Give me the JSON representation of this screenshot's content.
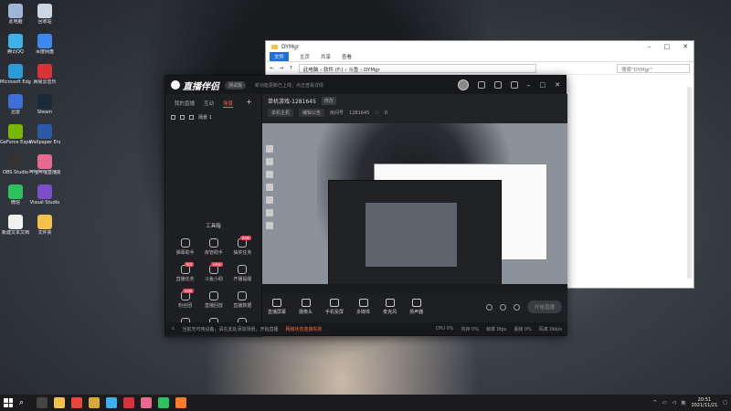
{
  "desktop": {
    "icons": [
      {
        "label": "此电脑",
        "color": "#9fb6d6"
      },
      {
        "label": "回收站",
        "color": "#cdd6e0"
      },
      {
        "label": "腾讯QQ",
        "color": "#3fb0e8"
      },
      {
        "label": "百度网盘",
        "color": "#3f88ef"
      },
      {
        "label": "Microsoft Edge",
        "color": "#2f9ad8"
      },
      {
        "label": "网易云音乐",
        "color": "#d8333a"
      },
      {
        "label": "迅雷",
        "color": "#3f6fd6"
      },
      {
        "label": "Steam",
        "color": "#1b2838"
      },
      {
        "label": "GeForce Experience",
        "color": "#76b900"
      },
      {
        "label": "Wallpaper Engine",
        "color": "#2a5aa6"
      },
      {
        "label": "OBS Studio",
        "color": "#333333"
      },
      {
        "label": "哔哩哔哩直播姬",
        "color": "#e86a8f"
      },
      {
        "label": "微信",
        "color": "#2dc160"
      },
      {
        "label": "Visual Studio",
        "color": "#7a4fc8"
      },
      {
        "label": "新建文本文档",
        "color": "#f0f0f0"
      },
      {
        "label": "文件夹",
        "color": "#f2c14e"
      }
    ]
  },
  "explorer": {
    "title": "DYMgr",
    "ribbon": [
      "文件",
      "主页",
      "共享",
      "查看"
    ],
    "path": [
      "此电脑",
      "软件 (F:)",
      "斗鱼",
      "DYMgr"
    ],
    "search_placeholder": "搜索\"DYMgr\""
  },
  "app": {
    "logo": "直播伴侣",
    "version": "测试版",
    "header_notice": "新功能更新已上线，点击查看详情",
    "left_tabs": [
      "我的直播",
      "互动",
      "场景"
    ],
    "active_tab": "场景",
    "scene_name": "场景 1",
    "toolbox_title": "工具箱",
    "tools": [
      {
        "label": "弹幕助手",
        "badge": ""
      },
      {
        "label": "房管助手",
        "badge": ""
      },
      {
        "label": "抽奖任务",
        "badge": "new"
      },
      {
        "label": "直播任务",
        "badge": "hot"
      },
      {
        "label": "斗鱼小助",
        "badge": "new"
      },
      {
        "label": "开播提醒",
        "badge": ""
      },
      {
        "label": "粉丝团",
        "badge": "new"
      },
      {
        "label": "直播回放",
        "badge": ""
      },
      {
        "label": "直播数据",
        "badge": ""
      },
      {
        "label": "更多",
        "badge": ""
      },
      {
        "label": "切片",
        "badge": ""
      },
      {
        "label": "设置",
        "badge": ""
      }
    ],
    "live": {
      "title": "单机游戏-1281645",
      "edit": "修改",
      "category": "单机主机",
      "notice": "编辑公告",
      "room_label": "房间号",
      "room": "1281645",
      "likes": "0"
    },
    "controls": [
      {
        "label": "直播屏幕",
        "icon": "monitor-icon"
      },
      {
        "label": "摄像头",
        "icon": "camera-icon"
      },
      {
        "label": "手机投屏",
        "icon": "phone-icon"
      },
      {
        "label": "多媒体",
        "icon": "media-icon"
      },
      {
        "label": "麦克风",
        "icon": "mic-icon"
      },
      {
        "label": "扬声器",
        "icon": "speaker-icon"
      }
    ],
    "start_live": "开始直播",
    "status": {
      "message": "当前无可用设备，请在此处添加场景，开始直播",
      "warning": "网络状态连接失败",
      "right": [
        "CPU 0%",
        "内存 0%",
        "帧率 0fps",
        "丢帧 0%",
        "码率 0kb/s"
      ]
    }
  },
  "taskbar": {
    "apps": [
      {
        "name": "search",
        "color": "#1c1c1e"
      },
      {
        "name": "task-view",
        "color": "#444"
      },
      {
        "name": "file-explorer",
        "color": "#f2c14e"
      },
      {
        "name": "chrome",
        "color": "#e8453c"
      },
      {
        "name": "app-g",
        "color": "#d6a93a"
      },
      {
        "name": "qq",
        "color": "#3fb0e8"
      },
      {
        "name": "netease-music",
        "color": "#d8333a"
      },
      {
        "name": "bilibili",
        "color": "#e86a8f"
      },
      {
        "name": "wechat",
        "color": "#2dc160"
      },
      {
        "name": "douyu",
        "color": "#ff7a2c"
      }
    ],
    "time": "20:51",
    "date": "2021/11/21"
  }
}
